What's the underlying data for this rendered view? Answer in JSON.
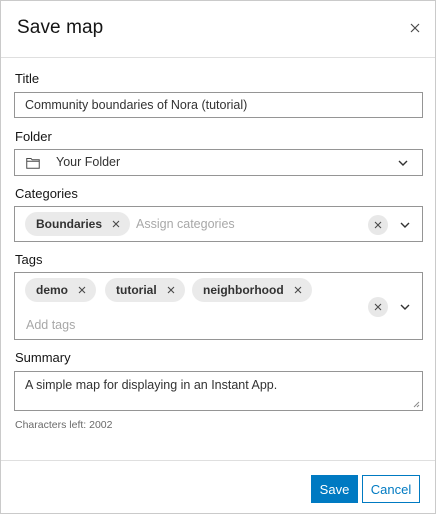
{
  "dialog": {
    "title": "Save map",
    "close_icon": "close-icon"
  },
  "title_field": {
    "label": "Title",
    "value": "Community boundaries of Nora (tutorial)"
  },
  "folder_field": {
    "label": "Folder",
    "icon": "folder-icon",
    "value": "Your Folder",
    "dropdown_icon": "chevron-down-icon"
  },
  "categories_field": {
    "label": "Categories",
    "chips": [
      {
        "label": "Boundaries"
      }
    ],
    "placeholder": "Assign categories"
  },
  "tags_field": {
    "label": "Tags",
    "chips": [
      {
        "label": "demo"
      },
      {
        "label": "tutorial"
      },
      {
        "label": "neighborhood"
      }
    ],
    "placeholder": "Add tags"
  },
  "summary_field": {
    "label": "Summary",
    "value": "A simple map for displaying in an Instant App.",
    "helper": "Characters left: 2002"
  },
  "footer": {
    "save_label": "Save",
    "cancel_label": "Cancel"
  },
  "colors": {
    "accent": "#007ac2",
    "chip_bg": "#eaeaea",
    "border": "#959595"
  }
}
